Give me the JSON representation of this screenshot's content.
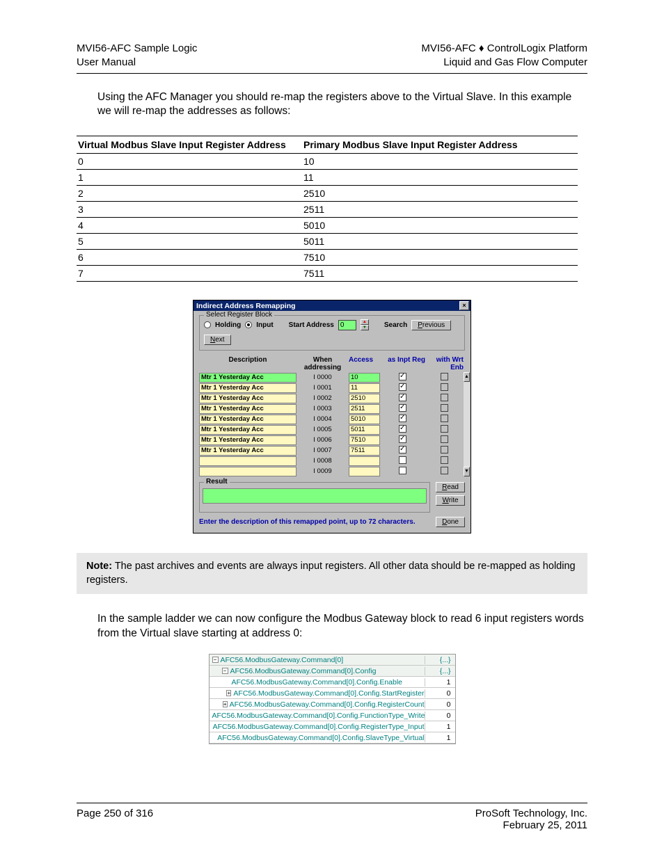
{
  "header": {
    "left_line1": "MVI56-AFC Sample Logic",
    "left_line2": "User Manual",
    "right_line1": "MVI56-AFC ♦ ControlLogix Platform",
    "right_line2": "Liquid and Gas Flow Computer"
  },
  "paragraphs": {
    "intro": "Using the AFC Manager you should re-map the registers above to the Virtual Slave. In this example we will re-map the addresses as follows:",
    "after_note": "In the sample ladder we can now configure the Modbus Gateway block to read 6 input registers words from the Virtual slave starting at address 0:"
  },
  "remap_table": {
    "col1": "Virtual Modbus Slave Input Register Address",
    "col2": "Primary Modbus Slave Input Register Address",
    "rows": [
      {
        "v": "0",
        "p": "10"
      },
      {
        "v": "1",
        "p": "11"
      },
      {
        "v": "2",
        "p": "2510"
      },
      {
        "v": "3",
        "p": "2511"
      },
      {
        "v": "4",
        "p": "5010"
      },
      {
        "v": "5",
        "p": "5011"
      },
      {
        "v": "6",
        "p": "7510"
      },
      {
        "v": "7",
        "p": "7511"
      }
    ]
  },
  "dialog": {
    "title": "Indirect Address Remapping",
    "select_block_legend": "Select Register Block",
    "holding_label": "Holding",
    "input_label": "Input",
    "start_address_label": "Start Address",
    "start_address_value": "0",
    "search_label": "Search",
    "previous_label": "Previous",
    "next_label": "Next",
    "col_description": "Description",
    "col_when": "When addressing",
    "col_access": "Access",
    "col_inpt": "as Inpt Reg",
    "col_wrt": "with Wrt Enb",
    "rows": [
      {
        "desc": "Mtr 1 Yesterday Acc",
        "addr": "I 0000",
        "acc": "10",
        "inpt": true,
        "green": true
      },
      {
        "desc": "Mtr 1 Yesterday Acc",
        "addr": "I 0001",
        "acc": "11",
        "inpt": true,
        "green": false
      },
      {
        "desc": "Mtr 1 Yesterday Acc",
        "addr": "I 0002",
        "acc": "2510",
        "inpt": true,
        "green": false
      },
      {
        "desc": "Mtr 1 Yesterday Acc",
        "addr": "I 0003",
        "acc": "2511",
        "inpt": true,
        "green": false
      },
      {
        "desc": "Mtr 1 Yesterday Acc",
        "addr": "I 0004",
        "acc": "5010",
        "inpt": true,
        "green": false
      },
      {
        "desc": "Mtr 1 Yesterday Acc",
        "addr": "I 0005",
        "acc": "5011",
        "inpt": true,
        "green": false
      },
      {
        "desc": "Mtr 1 Yesterday Acc",
        "addr": "I 0006",
        "acc": "7510",
        "inpt": true,
        "green": false
      },
      {
        "desc": "Mtr 1 Yesterday Acc",
        "addr": "I 0007",
        "acc": "7511",
        "inpt": true,
        "green": false
      },
      {
        "desc": "",
        "addr": "I 0008",
        "acc": "",
        "inpt": false,
        "green": false
      },
      {
        "desc": "",
        "addr": "I 0009",
        "acc": "",
        "inpt": false,
        "green": false
      }
    ],
    "result_legend": "Result",
    "read_label": "Read",
    "write_label": "Write",
    "done_label": "Done",
    "status_text": "Enter the description of this remapped point, up to 72 characters."
  },
  "note": {
    "label": "Note:",
    "text": " The past archives and events are always input registers. All other data should be re-mapped as holding registers."
  },
  "tree": {
    "rows": [
      {
        "indent": 0,
        "icon": "−",
        "label": "AFC56.ModbusGateway.Command[0]",
        "val": "{...}",
        "hdr": true,
        "dots": true
      },
      {
        "indent": 1,
        "icon": "−",
        "label": "AFC56.ModbusGateway.Command[0].Config",
        "val": "{...}",
        "hdr": true,
        "dots": true
      },
      {
        "indent": 2,
        "icon": "",
        "label": "AFC56.ModbusGateway.Command[0].Config.Enable",
        "val": "1",
        "hdr": false,
        "dots": false
      },
      {
        "indent": 2,
        "icon": "+",
        "label": "AFC56.ModbusGateway.Command[0].Config.StartRegister",
        "val": "0",
        "hdr": false,
        "dots": false
      },
      {
        "indent": 2,
        "icon": "+",
        "label": "AFC56.ModbusGateway.Command[0].Config.RegisterCount",
        "val": "0",
        "hdr": false,
        "dots": false
      },
      {
        "indent": 2,
        "icon": "",
        "label": "AFC56.ModbusGateway.Command[0].Config.FunctionType_Write",
        "val": "0",
        "hdr": false,
        "dots": false
      },
      {
        "indent": 2,
        "icon": "",
        "label": "AFC56.ModbusGateway.Command[0].Config.RegisterType_Input",
        "val": "1",
        "hdr": false,
        "dots": false
      },
      {
        "indent": 2,
        "icon": "",
        "label": "AFC56.ModbusGateway.Command[0].Config.SlaveType_Virtual",
        "val": "1",
        "hdr": false,
        "dots": false
      }
    ]
  },
  "footer": {
    "left": "Page 250 of 316",
    "right_line1": "ProSoft Technology, Inc.",
    "right_line2": "February 25, 2011"
  }
}
